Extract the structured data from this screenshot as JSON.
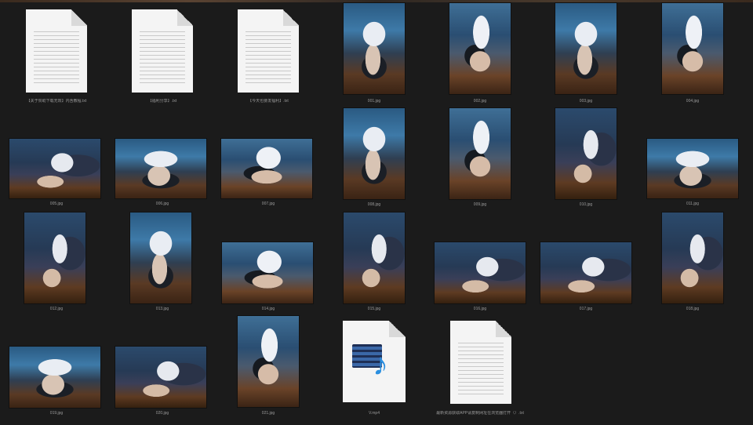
{
  "window": {
    "accent_strip_color": "#4a3a2c",
    "background": "#1b1b1b"
  },
  "files": [
    {
      "name": "【关于赞助下载无效】内含教程.txt",
      "type": "document"
    },
    {
      "name": "【福利分享】.txt",
      "type": "document"
    },
    {
      "name": "【今天也要发福利】.txt",
      "type": "document"
    },
    {
      "name": "001.jpg",
      "type": "image"
    },
    {
      "name": "002.jpg",
      "type": "image"
    },
    {
      "name": "003.jpg",
      "type": "image"
    },
    {
      "name": "004.jpg",
      "type": "image"
    },
    {
      "name": "005.jpg",
      "type": "image"
    },
    {
      "name": "006.jpg",
      "type": "image"
    },
    {
      "name": "007.jpg",
      "type": "image"
    },
    {
      "name": "008.jpg",
      "type": "image"
    },
    {
      "name": "009.jpg",
      "type": "image"
    },
    {
      "name": "010.jpg",
      "type": "image"
    },
    {
      "name": "011.jpg",
      "type": "image"
    },
    {
      "name": "012.jpg",
      "type": "image"
    },
    {
      "name": "013.jpg",
      "type": "image"
    },
    {
      "name": "014.jpg",
      "type": "image"
    },
    {
      "name": "015.jpg",
      "type": "image"
    },
    {
      "name": "016.jpg",
      "type": "image"
    },
    {
      "name": "017.jpg",
      "type": "image"
    },
    {
      "name": "018.jpg",
      "type": "image"
    },
    {
      "name": "019.jpg",
      "type": "image"
    },
    {
      "name": "020.jpg",
      "type": "image"
    },
    {
      "name": "021.jpg",
      "type": "image"
    },
    {
      "name": "V.mp4",
      "type": "video"
    },
    {
      "name": "最新资源获取APP请复制网址在浏览器打开（）.txt",
      "type": "document"
    }
  ]
}
